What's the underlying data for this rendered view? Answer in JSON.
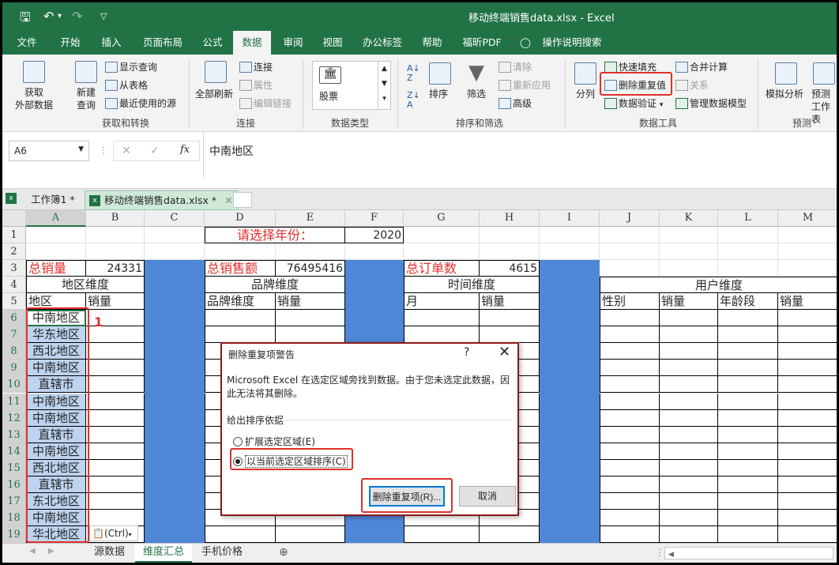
{
  "window": {
    "title": "移动终端销售data.xlsx  -  Excel"
  },
  "ribbon_tabs": [
    "文件",
    "开始",
    "插入",
    "页面布局",
    "公式",
    "数据",
    "审阅",
    "视图",
    "办公标签",
    "帮助",
    "福昕PDF",
    "操作说明搜索"
  ],
  "ribbon": {
    "get_data": "获取\n外部数据",
    "new_query": "新建\n查询",
    "show_query": "显示查询",
    "from_table": "从表格",
    "recent_sources": "最近使用的源",
    "group_get_transform": "获取和转换",
    "refresh_all": "全部刷新",
    "connections": "连接",
    "properties": "属性",
    "edit_links": "编辑链接",
    "group_connections": "连接",
    "stocks": "股票",
    "group_data_types": "数据类型",
    "sort": "排序",
    "filter": "筛选",
    "clear": "清除",
    "reapply": "重新应用",
    "advanced": "高级",
    "group_sort_filter": "排序和筛选",
    "text_to_columns": "分列",
    "flash_fill": "快速填充",
    "remove_duplicates": "删除重复值",
    "data_validation": "数据验证",
    "consolidate": "合并计算",
    "relationships": "关系",
    "manage_data_model": "管理数据模型",
    "group_data_tools": "数据工具",
    "what_if": "模拟分析",
    "forecast": "预测\n工作表",
    "group_forecast": "预测"
  },
  "formula_bar": {
    "name_box": "A6",
    "content": "中南地区",
    "fx": "fx"
  },
  "doc_tabs": [
    "工作簿1 *",
    "移动终端销售data.xlsx *"
  ],
  "columns": [
    "A",
    "B",
    "C",
    "D",
    "E",
    "F",
    "G",
    "H",
    "I",
    "J",
    "K",
    "L",
    "M"
  ],
  "rows": [
    "1",
    "2",
    "3",
    "4",
    "5",
    "6",
    "7",
    "8",
    "9",
    "10",
    "11",
    "12",
    "13",
    "14",
    "15",
    "16",
    "17",
    "18",
    "19"
  ],
  "sheet": {
    "year_prompt": "请选择年份：",
    "year": "2020",
    "total_sales_label": "总销量",
    "total_sales": "24331",
    "total_amount_label": "总销售额",
    "total_amount": "76495416",
    "total_orders_label": "总订单数",
    "total_orders": "4615",
    "region_dim": "地区维度",
    "brand_dim": "品牌维度",
    "time_dim": "时间维度",
    "user_dim": "用户维度",
    "region": "地区",
    "sales": "销量",
    "brand_dim_col": "品牌维度",
    "month": "月",
    "gender": "性别",
    "age_group": "年龄段",
    "regions": [
      "中南地区",
      "华东地区",
      "西北地区",
      "中南地区",
      "直辖市",
      "中南地区",
      "中南地区",
      "直辖市",
      "中南地区",
      "西北地区",
      "直辖市",
      "东北地区",
      "中南地区",
      "华北地区"
    ]
  },
  "annotation_number": "1",
  "paste_options": "(Ctrl)",
  "sheet_tabs": [
    "源数据",
    "维度汇总",
    "手机价格"
  ],
  "dialog": {
    "title": "删除重复项警告",
    "help": "?",
    "close": "✕",
    "message": "Microsoft Excel 在选定区域旁找到数据。由于您未选定此数据，因此无法将其删除。",
    "group_label": "给出排序依据",
    "option_expand": "扩展选定区域(E)",
    "option_current": "以当前选定区域排序(C)",
    "remove_button": "删除重复项(R)...",
    "cancel_button": "取消"
  }
}
